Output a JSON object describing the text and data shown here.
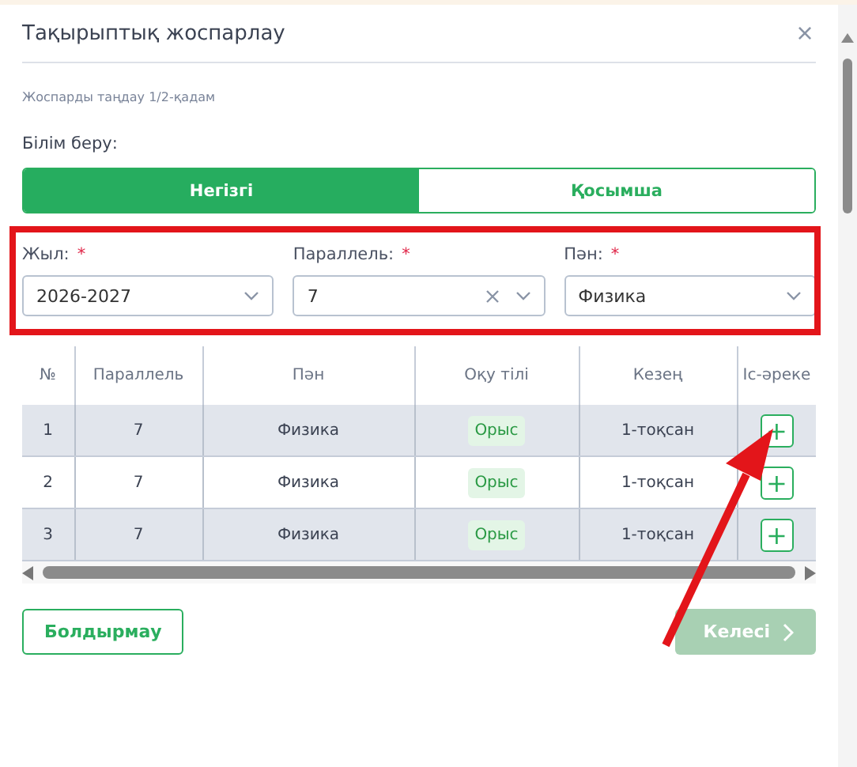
{
  "dialog": {
    "title": "Тақырыптық жоспарлау",
    "close": "×",
    "step": "Жоспарды таңдау 1/2-қадам"
  },
  "education": {
    "label": "Білім беру:",
    "options": [
      {
        "label": "Негізгі",
        "selected": true
      },
      {
        "label": "Қосымша",
        "selected": false
      }
    ]
  },
  "filters": [
    {
      "label": "Жыл:",
      "required_mark": "*",
      "value": "2026-2027",
      "clearable": false
    },
    {
      "label": "Параллель:",
      "required_mark": "*",
      "value": "7",
      "clearable": true
    },
    {
      "label": "Пән:",
      "required_mark": "*",
      "value": "Физика",
      "clearable": false
    }
  ],
  "table": {
    "columns": [
      "№",
      "Параллель",
      "Пән",
      "Оқу тілі",
      "Кезең",
      "Іс-әреке"
    ],
    "rows": [
      {
        "cells": [
          "1",
          "7",
          "Физика",
          "Орыс",
          "1-тоқсан"
        ],
        "action": "+"
      },
      {
        "cells": [
          "2",
          "7",
          "Физика",
          "Орыс",
          "1-тоқсан"
        ],
        "action": "+"
      },
      {
        "cells": [
          "3",
          "7",
          "Физика",
          "Орыс",
          "1-тоқсан"
        ],
        "action": "+"
      }
    ]
  },
  "buttons": {
    "cancel": {
      "label": "Болдырмау"
    },
    "next": {
      "label": "Келесі",
      "disabled": true
    }
  }
}
